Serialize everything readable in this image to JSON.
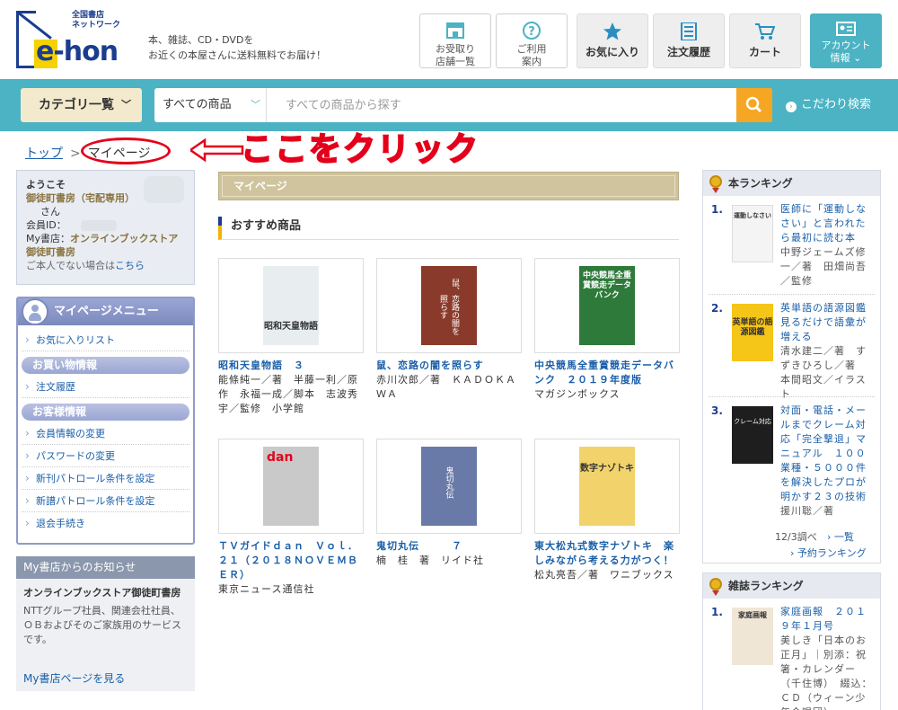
{
  "header": {
    "logo_line1": "全国書店",
    "logo_line2": "ネットワーク",
    "logo_word": "e-hon",
    "tagline_1": "本、雑誌、CD・DVDを",
    "tagline_2": "お近くの本屋さんに送料無料でお届け！",
    "buttons": [
      {
        "line1": "お受取り",
        "line2": "店舗一覧",
        "icon": "store-icon"
      },
      {
        "line1": "ご利用",
        "line2": "案内",
        "icon": "help-icon"
      },
      {
        "label": "お気に入り",
        "icon": "star-icon"
      },
      {
        "label": "注文履歴",
        "icon": "list-icon"
      },
      {
        "label": "カート",
        "icon": "cart-icon"
      },
      {
        "line1": "アカウント",
        "line2": "情報",
        "icon": "account-icon"
      }
    ]
  },
  "search": {
    "category_label": "カテゴリ一覧",
    "scope": "すべての商品",
    "placeholder": "すべての商品から探す",
    "advanced": "こだわり検索"
  },
  "breadcrumb": {
    "top": "トップ",
    "current": "マイページ"
  },
  "annotation": "ここをクリック",
  "welcome": {
    "greeting": "ようこそ",
    "store_name": "御徒町書房（宅配専用）",
    "honorific": "さん",
    "member_label": "会員ID：",
    "mystore_label": "My書店：",
    "mystore_name": "オンラインブックストア御徒町書房",
    "notme": "ご本人でない場合は",
    "here": "こちら"
  },
  "menu": {
    "title": "マイページメニュー",
    "favorites": "お気に入りリスト",
    "section_shopping": "お買い物情報",
    "orders": "注文履歴",
    "section_customer": "お客様情報",
    "items": [
      "会員情報の変更",
      "パスワードの変更",
      "新刊パトロール条件を設定",
      "新譜パトロール条件を設定",
      "退会手続き"
    ]
  },
  "notice": {
    "header": "My書店からのお知らせ",
    "title": "オンラインブックストア御徒町書房",
    "body": "NTTグループ社員、関連会社社員、ＯＢおよびそのご家族用のサービスです。",
    "link": "My書店ページを見る"
  },
  "main": {
    "page_title": "マイページ",
    "rec_title": "おすすめ商品",
    "products": [
      {
        "title": "昭和天皇物語　３",
        "author": "能條純一／著　半藤一利／原作　永福一成／脚本　志波秀宇／監修　小学館"
      },
      {
        "title": "鼠、恋路の闇を照らす",
        "author": "赤川次郎／著　ＫＡＤＯＫＡＷＡ"
      },
      {
        "title": "中央競馬全重賞競走データバンク　２０１９年度版",
        "author": "マガジンボックス"
      },
      {
        "title": "ＴＶガイドｄａｎ　Ｖｏｌ．２１（２０１８ＮＯＶＥＭＢＥＲ）",
        "author": "東京ニュース通信社"
      },
      {
        "title": "鬼切丸伝　　　７",
        "author": "楠　桂　著　リイド社"
      },
      {
        "title": "東大松丸式数字ナゾトキ　楽しみながら考える力がつく！",
        "author": "松丸亮吾／著　ワニブックス"
      }
    ],
    "covers": [
      {
        "text": "昭和天皇物語",
        "bg": "#e8eef0"
      },
      {
        "text": "鼠、恋路の闇を照らす",
        "bg": "#8a3a2a"
      },
      {
        "text": "中央競馬全重賞競走データバンク",
        "bg": "#2e7a3a"
      },
      {
        "text": "dan",
        "bg": "#c9c9c9"
      },
      {
        "text": "鬼切丸伝",
        "bg": "#6a7aa8"
      },
      {
        "text": "数字ナゾトキ",
        "bg": "#f2d36b"
      }
    ]
  },
  "ranking_books": {
    "title": "本ランキング",
    "items": [
      {
        "num": "1.",
        "title": "医師に「運動しなさい」と言われたら最初に読む本",
        "author": "中野ジェームズ修一／著　田畑尚吾／監修",
        "cover": "運動しなさい"
      },
      {
        "num": "2.",
        "title": "英単語の語源図鑑　見るだけで語彙が増える",
        "author": "清水建二／著　すずきひろし／著　本間昭文／イラスト",
        "cover": "英単語の語源図鑑"
      },
      {
        "num": "3.",
        "title": "対面・電話・メールまでクレーム対応「完全撃退」マニュアル　１００業種・５０００件を解決したプロが明かす２３の技術",
        "author": "援川聡／著",
        "cover": "クレーム対応"
      }
    ],
    "date": "12/3調べ",
    "more": "一覧",
    "preorder": "予約ランキング"
  },
  "ranking_magazines": {
    "title": "雑誌ランキング",
    "items": [
      {
        "num": "1.",
        "title": "家庭画報　２０１９年１月号",
        "author": "美しき「日本のお正月」｜別添：祝箸・カレンダー（千住博）　綴込：ＣＤ（ウィーン少年合唱団）",
        "cover": "家庭画報"
      }
    ]
  }
}
